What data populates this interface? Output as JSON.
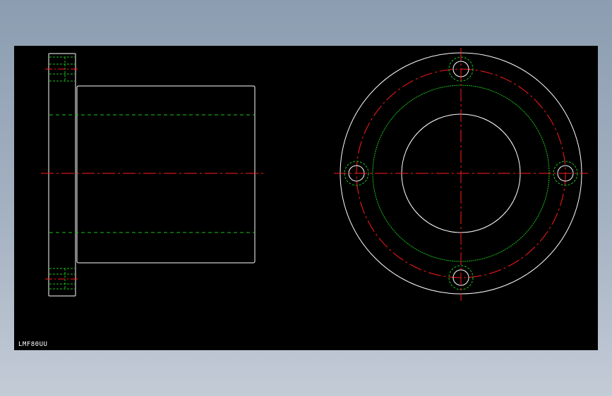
{
  "drawing": {
    "part_number": "LMF80UU",
    "colors": {
      "background": "#000000",
      "outline": "#ffffff",
      "hidden_line": "#19c419",
      "center_line": "#ff1a1a"
    }
  }
}
